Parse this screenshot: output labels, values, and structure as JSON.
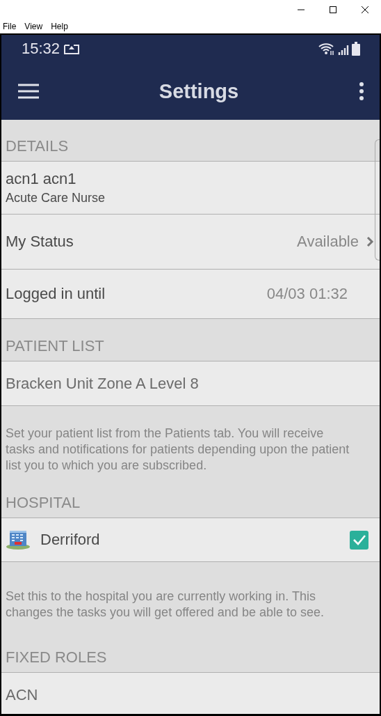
{
  "menu_bar": [
    "File",
    "View",
    "Help"
  ],
  "status_bar": {
    "time": "15:32"
  },
  "app_bar": {
    "title": "Settings"
  },
  "sections": [
    {
      "header": "DETAILS",
      "items": [
        {
          "kind": "person",
          "label": "acn1 acn1",
          "subtitle": "Acute Care Nurse"
        },
        {
          "kind": "link",
          "label": "My Status",
          "value": "Available"
        },
        {
          "kind": "value",
          "label": "Logged in until",
          "value": "04/03 01:32"
        }
      ]
    },
    {
      "header": "PATIENT LIST",
      "items": [
        {
          "kind": "plain",
          "label": "Bracken Unit Zone A Level 8"
        }
      ],
      "note": "Set your patient list from the Patients tab. You will receive tasks and notifications for patients depending upon the patient list you to which you are subscribed."
    },
    {
      "header": "HOSPITAL",
      "items": [
        {
          "kind": "check",
          "label": "Derriford",
          "checked": true
        }
      ],
      "note": "Set this to the hospital you are currently working in. This changes the tasks you will get offered and be able to see."
    },
    {
      "header": "FIXED ROLES",
      "items": [
        {
          "kind": "plain",
          "label": "ACN"
        }
      ]
    }
  ]
}
